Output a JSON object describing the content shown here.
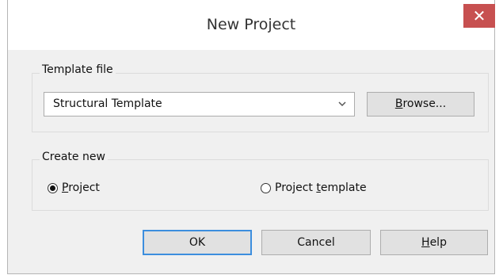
{
  "window": {
    "title": "New Project",
    "close_glyph": "✕"
  },
  "template_group": {
    "label": "Template file",
    "selected_template": "Structural Template",
    "dropdown_icon": "chevron-down-icon",
    "browse": {
      "mnemonic": "B",
      "rest": "rowse..."
    }
  },
  "create_group": {
    "label": "Create new",
    "options": [
      {
        "mnemonic": "P",
        "rest": "roject",
        "checked": true
      },
      {
        "before": "Project ",
        "mnemonic": "t",
        "rest": "emplate",
        "checked": false
      }
    ]
  },
  "buttons": {
    "ok": "OK",
    "cancel": "Cancel",
    "help": {
      "mnemonic": "H",
      "rest": "elp"
    }
  },
  "colors": {
    "close_button": "#c75050",
    "default_button_border": "#3c8ede"
  }
}
